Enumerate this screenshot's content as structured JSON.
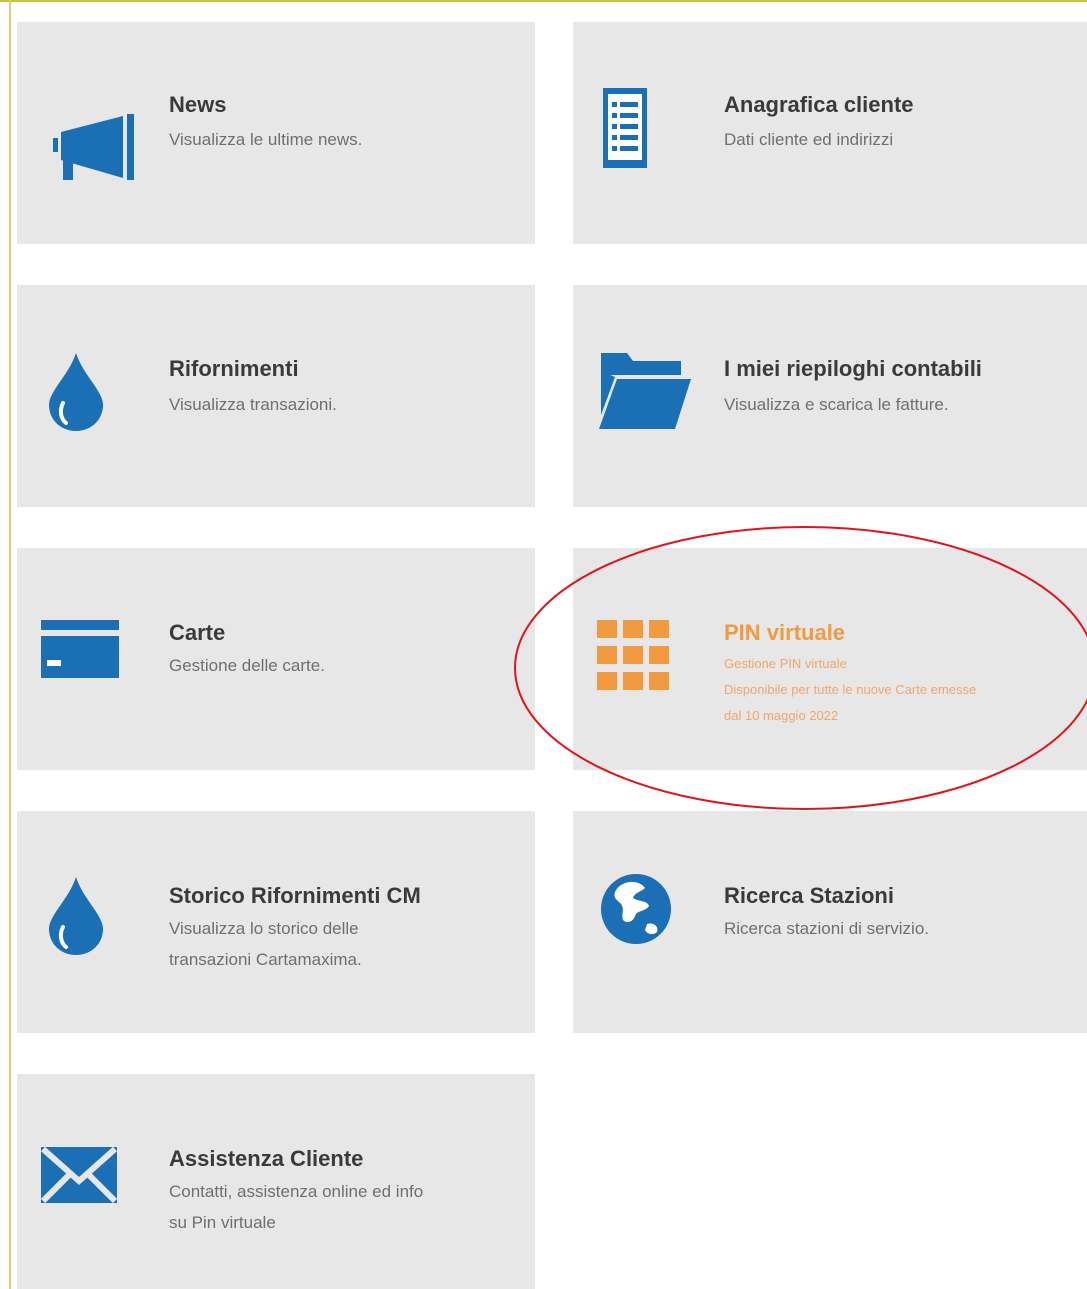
{
  "tiles": [
    {
      "key": "news",
      "title": "News",
      "desc": [
        "Visualizza le ultime news."
      ],
      "icon": "megaphone-icon"
    },
    {
      "key": "anagrafica",
      "title": "Anagrafica cliente",
      "desc": [
        "Dati cliente ed indirizzi"
      ],
      "icon": "list-document-icon"
    },
    {
      "key": "rifornimenti",
      "title": "Rifornimenti",
      "desc": [
        "Visualizza transazioni."
      ],
      "icon": "drop-icon"
    },
    {
      "key": "riepiloghi",
      "title": "I miei riepiloghi contabili",
      "desc": [
        "Visualizza e scarica le fatture."
      ],
      "icon": "folder-open-icon"
    },
    {
      "key": "carte",
      "title": "Carte",
      "desc": [
        "Gestione delle carte."
      ],
      "icon": "credit-card-icon"
    },
    {
      "key": "pin",
      "title": "PIN virtuale",
      "desc": [
        "Gestione PIN virtuale",
        "Disponibile per tutte le nuove Carte emesse",
        "dal 10 maggio 2022"
      ],
      "icon": "keypad-grid-icon",
      "highlighted": true
    },
    {
      "key": "storico",
      "title": "Storico Rifornimenti CM",
      "desc": [
        "Visualizza lo storico delle",
        "transazioni Cartamaxima."
      ],
      "icon": "drop-icon"
    },
    {
      "key": "stazioni",
      "title": "Ricerca Stazioni",
      "desc": [
        "Ricerca stazioni di servizio."
      ],
      "icon": "globe-icon"
    },
    {
      "key": "assistenza",
      "title": "Assistenza Cliente",
      "desc": [
        "Contatti, assistenza online ed info",
        "su Pin virtuale"
      ],
      "icon": "envelope-icon"
    }
  ],
  "colors": {
    "icon_blue": "#1a6fb5",
    "highlight_orange": "#f29a40",
    "tile_bg": "#e7e7e7",
    "annotation_red": "#e0151b"
  }
}
